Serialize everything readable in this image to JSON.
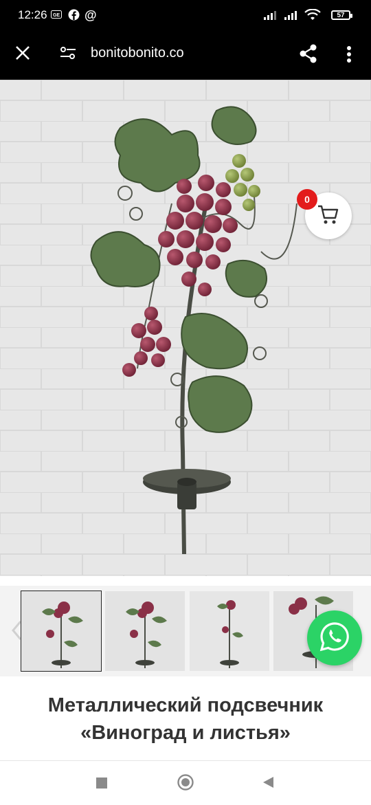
{
  "status_bar": {
    "time": "12:26",
    "battery": "57",
    "icons": [
      "ge-icon",
      "facebook-icon",
      "at-icon",
      "signal-icon",
      "signal-icon",
      "wifi-icon",
      "battery-icon"
    ]
  },
  "browser": {
    "url": "bonitobonito.co",
    "icons": [
      "close-icon",
      "site-settings-icon",
      "share-icon",
      "more-icon"
    ]
  },
  "cart": {
    "count": "0",
    "icon": "cart-icon"
  },
  "product": {
    "title_line1": "Металлический подсвечник",
    "title_line2": "«Виноград и листья»"
  },
  "thumbnails": {
    "count_visible": 4,
    "prev_icon": "chevron-left-icon"
  },
  "colors": {
    "bar_bg": "#000000",
    "badge": "#e31b1b",
    "whatsapp": "#2bd366",
    "title": "#333333"
  }
}
